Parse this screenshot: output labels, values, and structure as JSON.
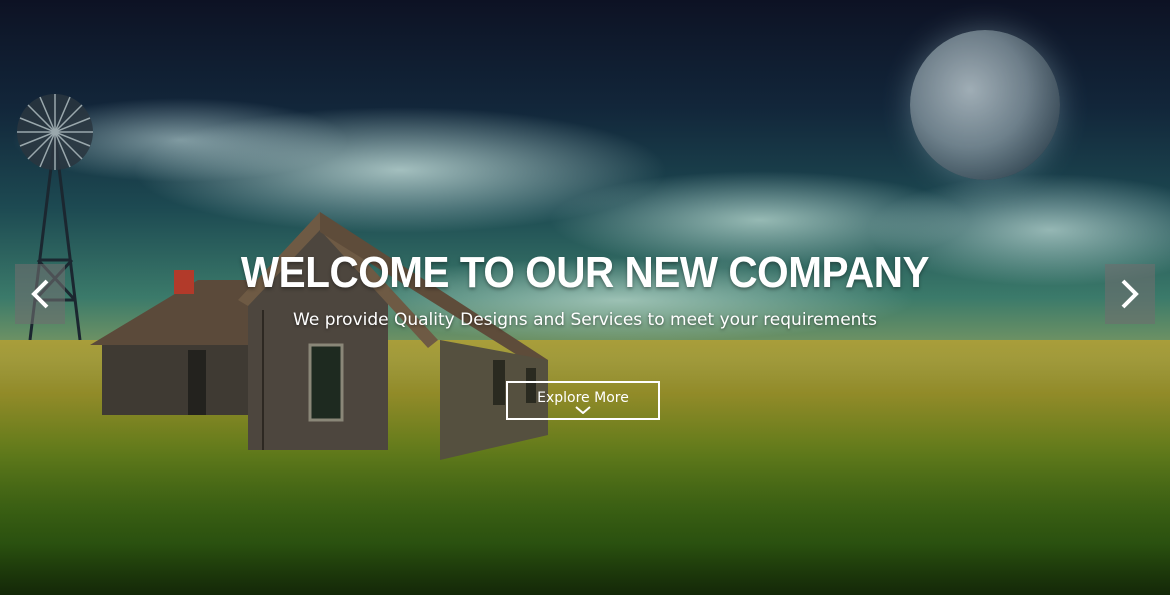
{
  "hero": {
    "headline": "WELCOME TO OUR NEW COMPANY",
    "subheadline": "We provide Quality Designs and Services to meet your requirements",
    "cta_label": "Explore More",
    "background_scene": "prairie-landscape-image"
  },
  "navigation": {
    "prev_icon": "chevron-left-icon",
    "next_icon": "chevron-right-icon"
  },
  "colors": {
    "text": "#ffffff",
    "arrow_bg": "#6e6e6e"
  }
}
